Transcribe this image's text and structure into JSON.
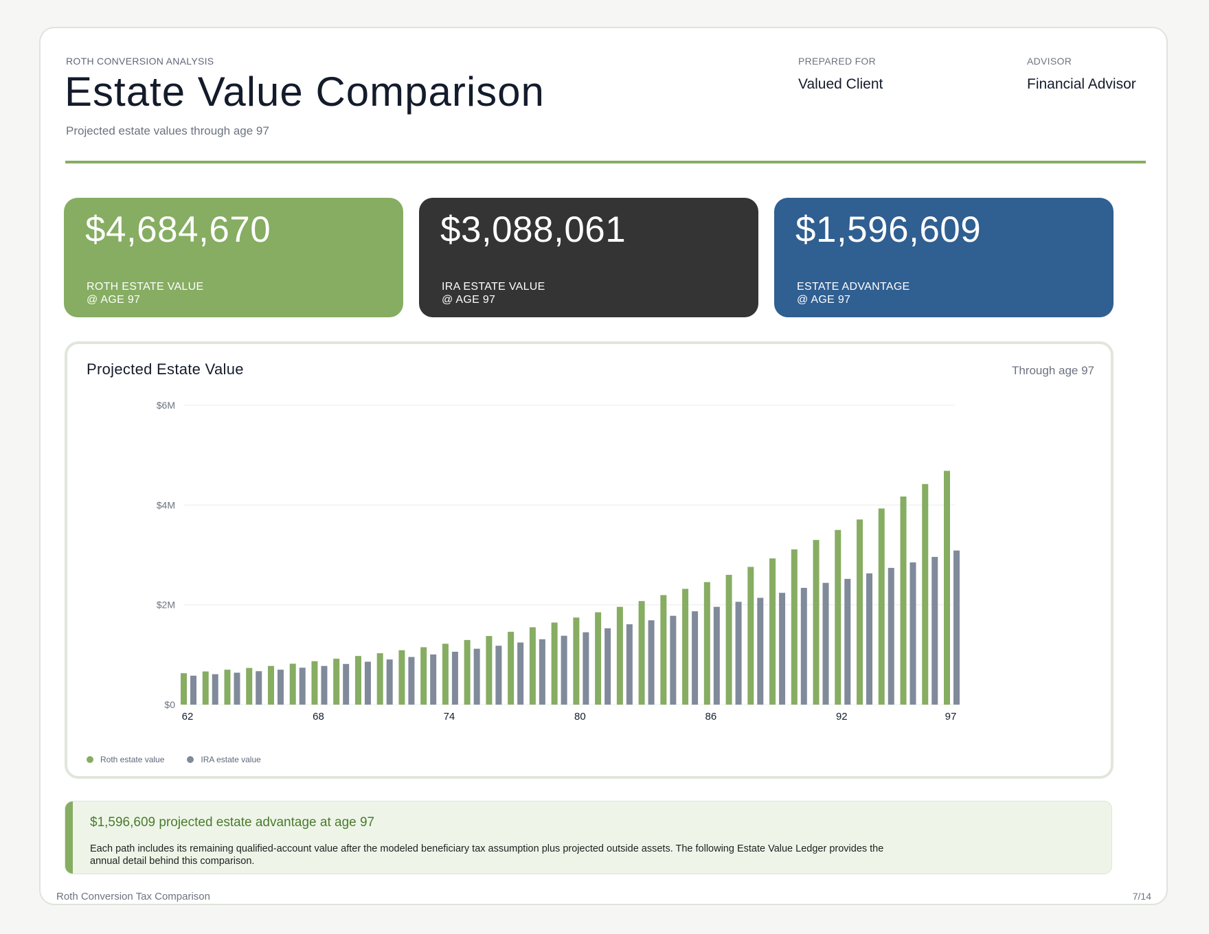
{
  "header": {
    "eyebrow": "ROTH CONVERSION ANALYSIS",
    "title": "Estate Value Comparison",
    "subtitle": "Projected estate values through age 97",
    "prepared_for_label": "PREPARED FOR",
    "prepared_for_value": "Valued Client",
    "advisor_label": "ADVISOR",
    "advisor_value": "Financial Advisor"
  },
  "kpis": [
    {
      "value": "$4,684,670",
      "label_line1": "ROTH ESTATE VALUE",
      "label_line2": "@ AGE 97",
      "color": "#86ad62"
    },
    {
      "value": "$3,088,061",
      "label_line1": "IRA ESTATE VALUE",
      "label_line2": "@ AGE 97",
      "color": "#343434"
    },
    {
      "value": "$1,596,609",
      "label_line1": "ESTATE ADVANTAGE",
      "label_line2": "@ AGE 97",
      "color": "#305f91"
    }
  ],
  "chart_card": {
    "title": "Projected Estate Value",
    "subtitle": "Through age 97"
  },
  "chart_data": {
    "type": "bar",
    "title": "Projected Estate Value",
    "xlabel": "",
    "ylabel": "",
    "categories": [
      62,
      63,
      64,
      65,
      66,
      67,
      68,
      69,
      70,
      71,
      72,
      73,
      74,
      75,
      76,
      77,
      78,
      79,
      80,
      81,
      82,
      83,
      84,
      85,
      86,
      87,
      88,
      89,
      90,
      91,
      92,
      93,
      94,
      95,
      96,
      97
    ],
    "x_tick_labels": [
      "62",
      "68",
      "74",
      "80",
      "86",
      "92",
      "97"
    ],
    "y_tick_labels": [
      "$0",
      "$2M",
      "$4M",
      "$6M"
    ],
    "ylim": [
      0,
      6000000
    ],
    "grid": true,
    "legend_position": "bottom-left",
    "series": [
      {
        "name": "Roth estate value",
        "color": "#86ad62",
        "values": [
          630000,
          665000,
          700000,
          735000,
          775000,
          820000,
          870000,
          920000,
          975000,
          1030000,
          1090000,
          1150000,
          1220000,
          1295000,
          1375000,
          1460000,
          1550000,
          1645000,
          1745000,
          1850000,
          1960000,
          2075000,
          2195000,
          2320000,
          2455000,
          2600000,
          2760000,
          2930000,
          3110000,
          3300000,
          3500000,
          3710000,
          3930000,
          4170000,
          4420000,
          4684670
        ]
      },
      {
        "name": "IRA estate value",
        "color": "#808a9b",
        "values": [
          580000,
          610000,
          640000,
          670000,
          700000,
          740000,
          775000,
          815000,
          860000,
          905000,
          955000,
          1005000,
          1060000,
          1120000,
          1180000,
          1245000,
          1310000,
          1380000,
          1450000,
          1530000,
          1610000,
          1690000,
          1780000,
          1870000,
          1960000,
          2060000,
          2140000,
          2240000,
          2340000,
          2440000,
          2520000,
          2630000,
          2740000,
          2850000,
          2960000,
          3088061
        ]
      }
    ]
  },
  "note": {
    "title": "$1,596,609 projected estate advantage at age 97",
    "body": "Each path includes its remaining qualified-account value after the modeled beneficiary tax assumption plus projected outside assets. The following Estate Value Ledger provides the annual detail behind this comparison."
  },
  "footer": {
    "left": "Roth Conversion Tax Comparison",
    "right": "7/14"
  }
}
